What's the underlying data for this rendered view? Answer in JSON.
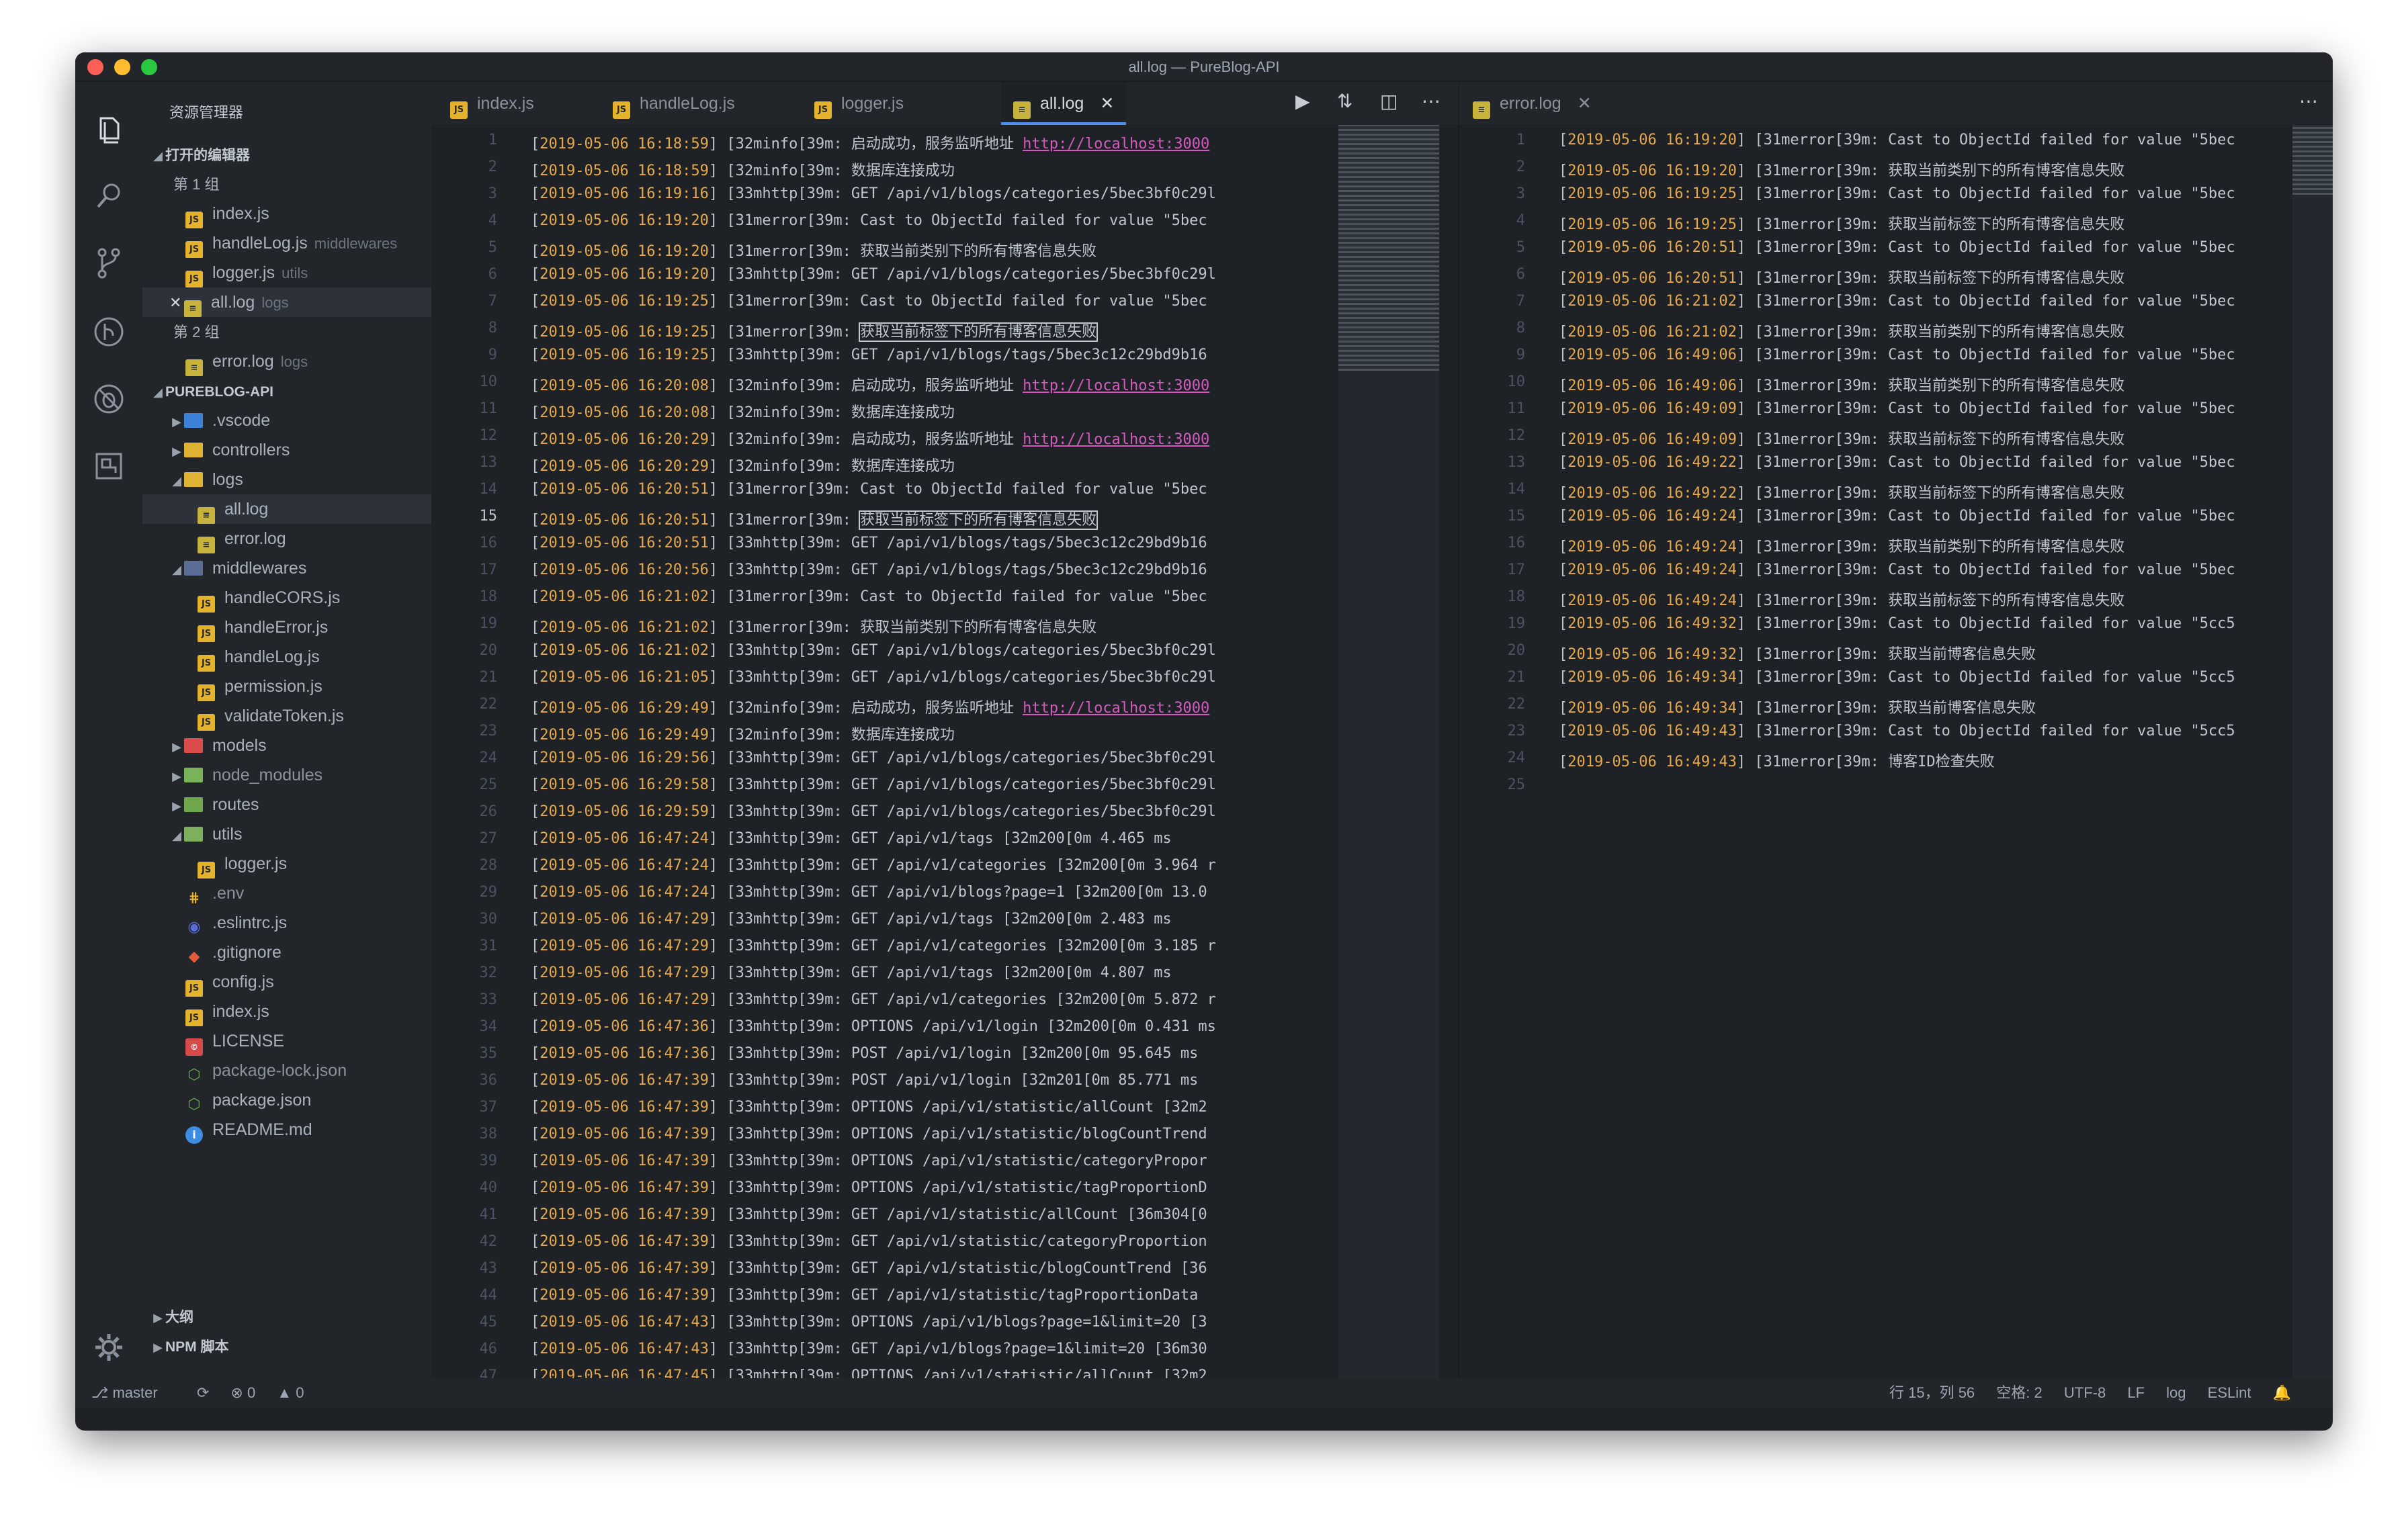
{
  "window_title": "all.log — PureBlog-API",
  "sidebar": {
    "title": "资源管理器",
    "open_editors": "打开的编辑器",
    "group1": "第 1 组",
    "group1_files": [
      {
        "name": "index.js",
        "hint": ""
      },
      {
        "name": "handleLog.js",
        "hint": "middlewares"
      },
      {
        "name": "logger.js",
        "hint": "utils"
      },
      {
        "name": "all.log",
        "hint": "logs"
      }
    ],
    "group2": "第 2 组",
    "group2_files": [
      {
        "name": "error.log",
        "hint": "logs"
      }
    ],
    "project": "PUREBLOG-API",
    "tree": [
      ".vscode",
      "controllers",
      "logs",
      "all.log",
      "error.log",
      "middlewares",
      "handleCORS.js",
      "handleError.js",
      "handleLog.js",
      "permission.js",
      "validateToken.js",
      "models",
      "node_modules",
      "routes",
      "utils",
      "logger.js",
      ".env",
      ".eslintrc.js",
      ".gitignore",
      "config.js",
      "index.js",
      "LICENSE",
      "package-lock.json",
      "package.json",
      "README.md"
    ],
    "outline": "大纲",
    "npm": "NPM 脚本"
  },
  "tabs_left": [
    "index.js",
    "handleLog.js",
    "logger.js",
    "all.log"
  ],
  "tab_right": "error.log",
  "status": {
    "branch": "master",
    "errors": "⊗ 0",
    "warnings": "▲ 0",
    "position": "行 15，列 56",
    "spaces": "空格: 2",
    "encoding": "UTF-8",
    "eol": "LF",
    "lang": "log",
    "lint": "ESLint"
  },
  "left_lines": [
    [
      "2019-05-06 16:18:59",
      "[32minfo[39m: 启动成功，服务监听地址 ",
      "http://localhost:3000"
    ],
    [
      "2019-05-06 16:18:59",
      "[32minfo[39m: 数据库连接成功",
      ""
    ],
    [
      "2019-05-06 16:19:16",
      "[33mhttp[39m: GET /api/v1/blogs/categories/5bec3bf0c29l",
      ""
    ],
    [
      "2019-05-06 16:19:20",
      "[31merror[39m: Cast to ObjectId failed for value \"5bec",
      ""
    ],
    [
      "2019-05-06 16:19:20",
      "[31merror[39m: 获取当前类别下的所有博客信息失败",
      ""
    ],
    [
      "2019-05-06 16:19:20",
      "[33mhttp[39m: GET /api/v1/blogs/categories/5bec3bf0c29l",
      ""
    ],
    [
      "2019-05-06 16:19:25",
      "[31merror[39m: Cast to ObjectId failed for value \"5bec",
      ""
    ],
    [
      "2019-05-06 16:19:25",
      "[31merror[39m: 获取当前标签下的所有博客信息失败",
      ""
    ],
    [
      "2019-05-06 16:19:25",
      "[33mhttp[39m: GET /api/v1/blogs/tags/5bec3c12c29bd9b16",
      ""
    ],
    [
      "2019-05-06 16:20:08",
      "[32minfo[39m: 启动成功，服务监听地址 ",
      "http://localhost:3000"
    ],
    [
      "2019-05-06 16:20:08",
      "[32minfo[39m: 数据库连接成功",
      ""
    ],
    [
      "2019-05-06 16:20:29",
      "[32minfo[39m: 启动成功，服务监听地址 ",
      "http://localhost:3000"
    ],
    [
      "2019-05-06 16:20:29",
      "[32minfo[39m: 数据库连接成功",
      ""
    ],
    [
      "2019-05-06 16:20:51",
      "[31merror[39m: Cast to ObjectId failed for value \"5bec",
      ""
    ],
    [
      "2019-05-06 16:20:51",
      "[31merror[39m: 获取当前标签下的所有博客信息失败",
      ""
    ],
    [
      "2019-05-06 16:20:51",
      "[33mhttp[39m: GET /api/v1/blogs/tags/5bec3c12c29bd9b16",
      ""
    ],
    [
      "2019-05-06 16:20:56",
      "[33mhttp[39m: GET /api/v1/blogs/tags/5bec3c12c29bd9b16",
      ""
    ],
    [
      "2019-05-06 16:21:02",
      "[31merror[39m: Cast to ObjectId failed for value \"5bec",
      ""
    ],
    [
      "2019-05-06 16:21:02",
      "[31merror[39m: 获取当前类别下的所有博客信息失败",
      ""
    ],
    [
      "2019-05-06 16:21:02",
      "[33mhttp[39m: GET /api/v1/blogs/categories/5bec3bf0c29l",
      ""
    ],
    [
      "2019-05-06 16:21:05",
      "[33mhttp[39m: GET /api/v1/blogs/categories/5bec3bf0c29l",
      ""
    ],
    [
      "2019-05-06 16:29:49",
      "[32minfo[39m: 启动成功，服务监听地址 ",
      "http://localhost:3000"
    ],
    [
      "2019-05-06 16:29:49",
      "[32minfo[39m: 数据库连接成功",
      ""
    ],
    [
      "2019-05-06 16:29:56",
      "[33mhttp[39m: GET /api/v1/blogs/categories/5bec3bf0c29l",
      ""
    ],
    [
      "2019-05-06 16:29:58",
      "[33mhttp[39m: GET /api/v1/blogs/categories/5bec3bf0c29l",
      ""
    ],
    [
      "2019-05-06 16:29:59",
      "[33mhttp[39m: GET /api/v1/blogs/categories/5bec3bf0c29l",
      ""
    ],
    [
      "2019-05-06 16:47:24",
      "[33mhttp[39m: GET /api/v1/tags [32m200[0m 4.465 ms",
      ""
    ],
    [
      "2019-05-06 16:47:24",
      "[33mhttp[39m: GET /api/v1/categories [32m200[0m 3.964 r",
      ""
    ],
    [
      "2019-05-06 16:47:24",
      "[33mhttp[39m: GET /api/v1/blogs?page=1 [32m200[0m 13.0",
      ""
    ],
    [
      "2019-05-06 16:47:29",
      "[33mhttp[39m: GET /api/v1/tags [32m200[0m 2.483 ms",
      ""
    ],
    [
      "2019-05-06 16:47:29",
      "[33mhttp[39m: GET /api/v1/categories [32m200[0m 3.185 r",
      ""
    ],
    [
      "2019-05-06 16:47:29",
      "[33mhttp[39m: GET /api/v1/tags [32m200[0m 4.807 ms",
      ""
    ],
    [
      "2019-05-06 16:47:29",
      "[33mhttp[39m: GET /api/v1/categories [32m200[0m 5.872 r",
      ""
    ],
    [
      "2019-05-06 16:47:36",
      "[33mhttp[39m: OPTIONS /api/v1/login [32m200[0m 0.431 ms",
      ""
    ],
    [
      "2019-05-06 16:47:36",
      "[33mhttp[39m: POST /api/v1/login [32m200[0m 95.645 ms",
      ""
    ],
    [
      "2019-05-06 16:47:39",
      "[33mhttp[39m: POST /api/v1/login [32m201[0m 85.771 ms",
      ""
    ],
    [
      "2019-05-06 16:47:39",
      "[33mhttp[39m: OPTIONS /api/v1/statistic/allCount [32m2",
      ""
    ],
    [
      "2019-05-06 16:47:39",
      "[33mhttp[39m: OPTIONS /api/v1/statistic/blogCountTrend",
      ""
    ],
    [
      "2019-05-06 16:47:39",
      "[33mhttp[39m: OPTIONS /api/v1/statistic/categoryPropor",
      ""
    ],
    [
      "2019-05-06 16:47:39",
      "[33mhttp[39m: OPTIONS /api/v1/statistic/tagProportionD",
      ""
    ],
    [
      "2019-05-06 16:47:39",
      "[33mhttp[39m: GET /api/v1/statistic/allCount [36m304[0",
      ""
    ],
    [
      "2019-05-06 16:47:39",
      "[33mhttp[39m: GET /api/v1/statistic/categoryProportion",
      ""
    ],
    [
      "2019-05-06 16:47:39",
      "[33mhttp[39m: GET /api/v1/statistic/blogCountTrend [36",
      ""
    ],
    [
      "2019-05-06 16:47:39",
      "[33mhttp[39m: GET /api/v1/statistic/tagProportionData",
      ""
    ],
    [
      "2019-05-06 16:47:43",
      "[33mhttp[39m: OPTIONS /api/v1/blogs?page=1&limit=20 [3",
      ""
    ],
    [
      "2019-05-06 16:47:43",
      "[33mhttp[39m: GET /api/v1/blogs?page=1&limit=20 [36m30",
      ""
    ],
    [
      "2019-05-06 16:47:45",
      "[33mhttp[39m: OPTIONS /api/v1/statistic/allCount [32m2",
      ""
    ]
  ],
  "right_lines": [
    [
      "2019-05-06 16:19:20",
      "[31merror[39m: Cast to ObjectId failed for value \"5bec"
    ],
    [
      "2019-05-06 16:19:20",
      "[31merror[39m: 获取当前类别下的所有博客信息失败"
    ],
    [
      "2019-05-06 16:19:25",
      "[31merror[39m: Cast to ObjectId failed for value \"5bec"
    ],
    [
      "2019-05-06 16:19:25",
      "[31merror[39m: 获取当前标签下的所有博客信息失败"
    ],
    [
      "2019-05-06 16:20:51",
      "[31merror[39m: Cast to ObjectId failed for value \"5bec"
    ],
    [
      "2019-05-06 16:20:51",
      "[31merror[39m: 获取当前标签下的所有博客信息失败"
    ],
    [
      "2019-05-06 16:21:02",
      "[31merror[39m: Cast to ObjectId failed for value \"5bec"
    ],
    [
      "2019-05-06 16:21:02",
      "[31merror[39m: 获取当前类别下的所有博客信息失败"
    ],
    [
      "2019-05-06 16:49:06",
      "[31merror[39m: Cast to ObjectId failed for value \"5bec"
    ],
    [
      "2019-05-06 16:49:06",
      "[31merror[39m: 获取当前类别下的所有博客信息失败"
    ],
    [
      "2019-05-06 16:49:09",
      "[31merror[39m: Cast to ObjectId failed for value \"5bec"
    ],
    [
      "2019-05-06 16:49:09",
      "[31merror[39m: 获取当前标签下的所有博客信息失败"
    ],
    [
      "2019-05-06 16:49:22",
      "[31merror[39m: Cast to ObjectId failed for value \"5bec"
    ],
    [
      "2019-05-06 16:49:22",
      "[31merror[39m: 获取当前标签下的所有博客信息失败"
    ],
    [
      "2019-05-06 16:49:24",
      "[31merror[39m: Cast to ObjectId failed for value \"5bec"
    ],
    [
      "2019-05-06 16:49:24",
      "[31merror[39m: 获取当前类别下的所有博客信息失败"
    ],
    [
      "2019-05-06 16:49:24",
      "[31merror[39m: Cast to ObjectId failed for value \"5bec"
    ],
    [
      "2019-05-06 16:49:24",
      "[31merror[39m: 获取当前标签下的所有博客信息失败"
    ],
    [
      "2019-05-06 16:49:32",
      "[31merror[39m: Cast to ObjectId failed for value \"5cc5"
    ],
    [
      "2019-05-06 16:49:32",
      "[31merror[39m: 获取当前博客信息失败"
    ],
    [
      "2019-05-06 16:49:34",
      "[31merror[39m: Cast to ObjectId failed for value \"5cc5"
    ],
    [
      "2019-05-06 16:49:34",
      "[31merror[39m: 获取当前博客信息失败"
    ],
    [
      "2019-05-06 16:49:43",
      "[31merror[39m: Cast to ObjectId failed for value \"5cc5"
    ],
    [
      "2019-05-06 16:49:43",
      "[31merror[39m: 博客ID检查失败"
    ]
  ],
  "right_last_line": "25",
  "current_line": 15
}
